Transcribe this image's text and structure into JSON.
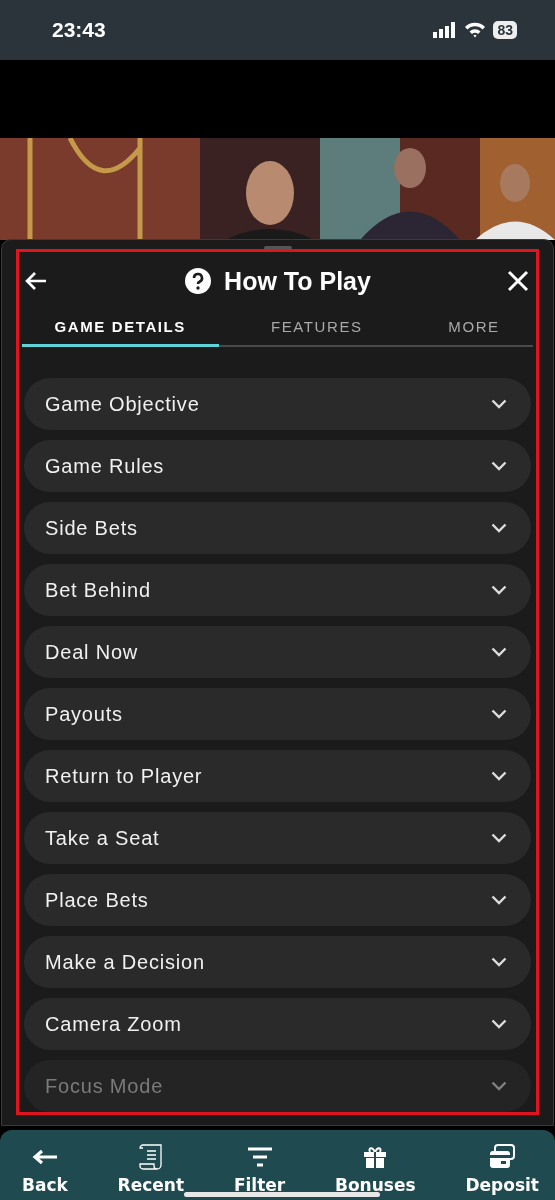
{
  "status_bar": {
    "time": "23:43",
    "battery": "83"
  },
  "dialog": {
    "title": "How To Play",
    "tabs": [
      {
        "label": "GAME DETAILS",
        "selected": true
      },
      {
        "label": "FEATURES",
        "selected": false
      },
      {
        "label": "MORE",
        "selected": false
      }
    ],
    "sections": [
      {
        "label": "Game Objective",
        "dimmed": false
      },
      {
        "label": "Game Rules",
        "dimmed": false
      },
      {
        "label": "Side Bets",
        "dimmed": false
      },
      {
        "label": "Bet Behind",
        "dimmed": false
      },
      {
        "label": "Deal Now",
        "dimmed": false
      },
      {
        "label": "Payouts",
        "dimmed": false
      },
      {
        "label": "Return to Player",
        "dimmed": false
      },
      {
        "label": "Take a Seat",
        "dimmed": false
      },
      {
        "label": "Place Bets",
        "dimmed": false
      },
      {
        "label": "Make a Decision",
        "dimmed": false
      },
      {
        "label": "Camera Zoom",
        "dimmed": false
      },
      {
        "label": "Focus Mode",
        "dimmed": true
      }
    ]
  },
  "bottom_nav": [
    {
      "kind": "back",
      "label": "Back"
    },
    {
      "kind": "recent",
      "label": "Recent"
    },
    {
      "kind": "filter",
      "label": "Filter"
    },
    {
      "kind": "bonuses",
      "label": "Bonuses"
    },
    {
      "kind": "deposit",
      "label": "Deposit"
    }
  ]
}
